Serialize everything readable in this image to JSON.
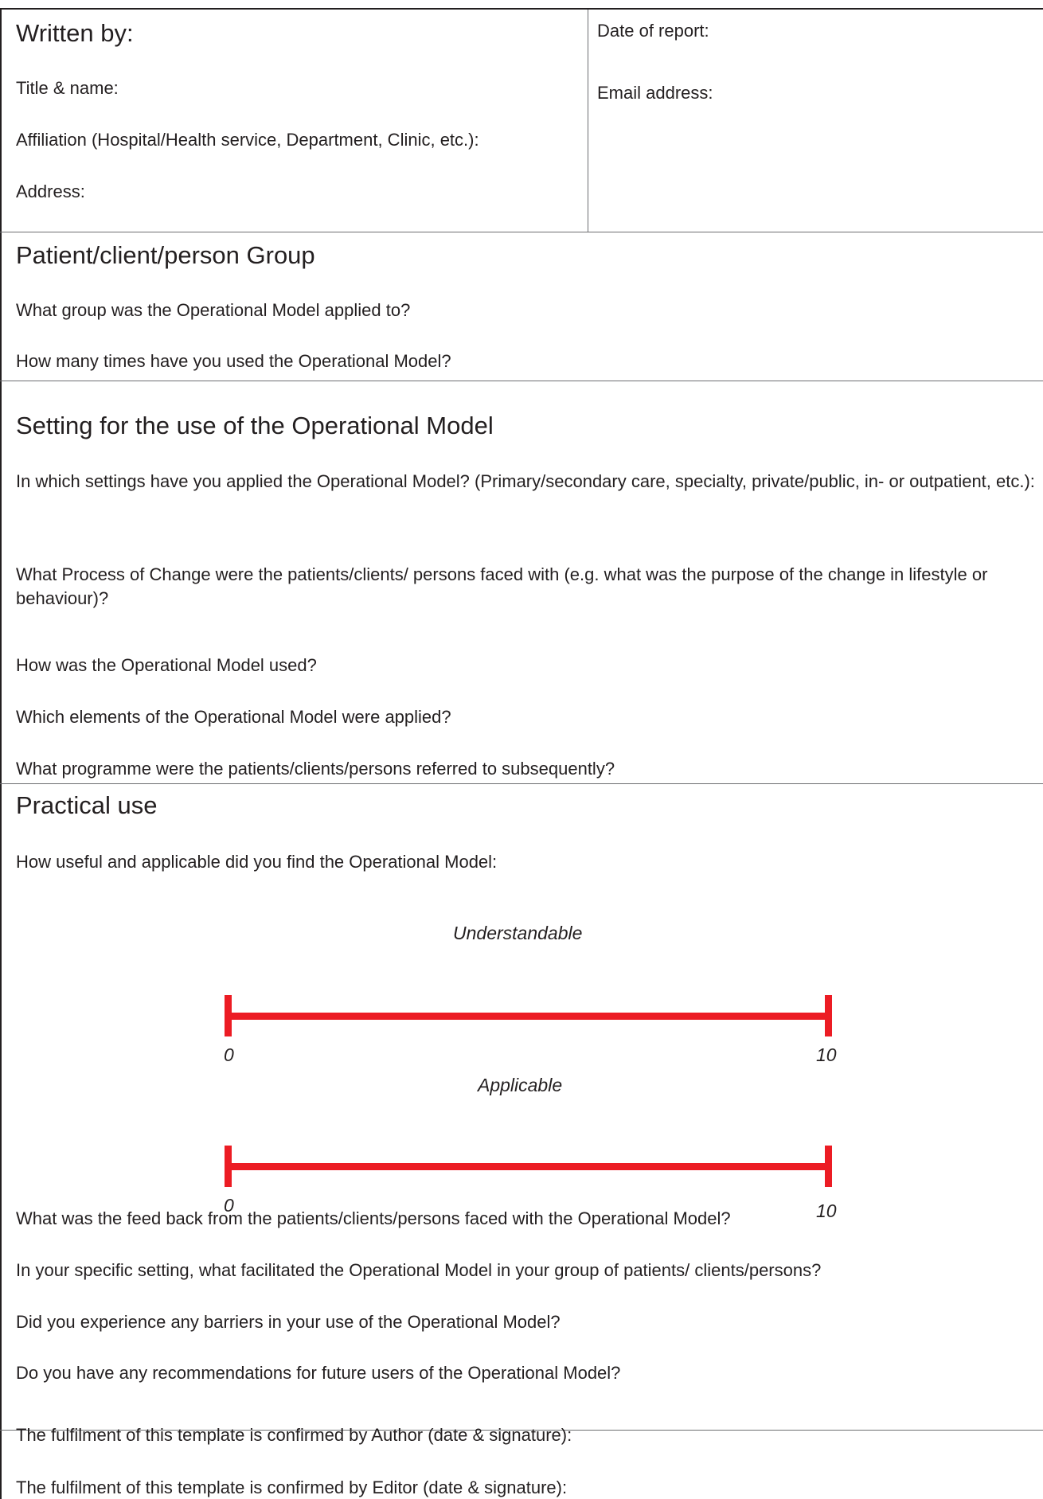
{
  "header": {
    "written_by": "Written by:",
    "title_name": "Title & name:",
    "affiliation": "Affiliation (Hospital/Health service, Department, Clinic, etc.):",
    "address": "Address:",
    "date_of_report": "Date of report:",
    "email_address": "Email address:"
  },
  "patient_group": {
    "heading": "Patient/client/person Group",
    "q1": "What group was the Operational Model applied to?",
    "q2": "How many times have you used the Operational Model?"
  },
  "setting": {
    "heading": "Setting for the use of the Operational Model",
    "q1": "In which settings have you applied the Operational Model? (Primary/secondary care, specialty, private/public, in- or outpatient, etc.):",
    "q2": "What Process of Change were the patients/clients/ persons faced with (e.g. what was the purpose of the change in lifestyle or behaviour)?",
    "q3": "How was the Operational Model used?",
    "q4": "Which elements of the Operational Model were applied?",
    "q5": "What programme were the patients/clients/persons referred to subsequently?"
  },
  "practical": {
    "heading": "Practical use",
    "intro": "How useful and applicable did you find the Operational Model:",
    "scales": [
      {
        "label": "Understandable",
        "min": "0",
        "max": "10"
      },
      {
        "label": "Applicable",
        "min": "0",
        "max": "10"
      }
    ],
    "q1": "What was the feed back from the patients/clients/persons faced with the Operational Model?",
    "q2": "In your specific setting, what facilitated the Operational Model in your group of patients/ clients/persons?",
    "q3": "Did you experience any barriers in your use of the Operational Model?",
    "q4": "Do you have any recommendations for future users of the Operational Model?"
  },
  "confirmation": {
    "author": "The fulfilment of this template is confirmed by Author (date & signature):",
    "editor": "The fulfilment of this template is confirmed by Editor (date & signature):"
  },
  "colors": {
    "scale_red": "#ec1c24",
    "text": "#231f20",
    "rule": "#6d6e71"
  }
}
